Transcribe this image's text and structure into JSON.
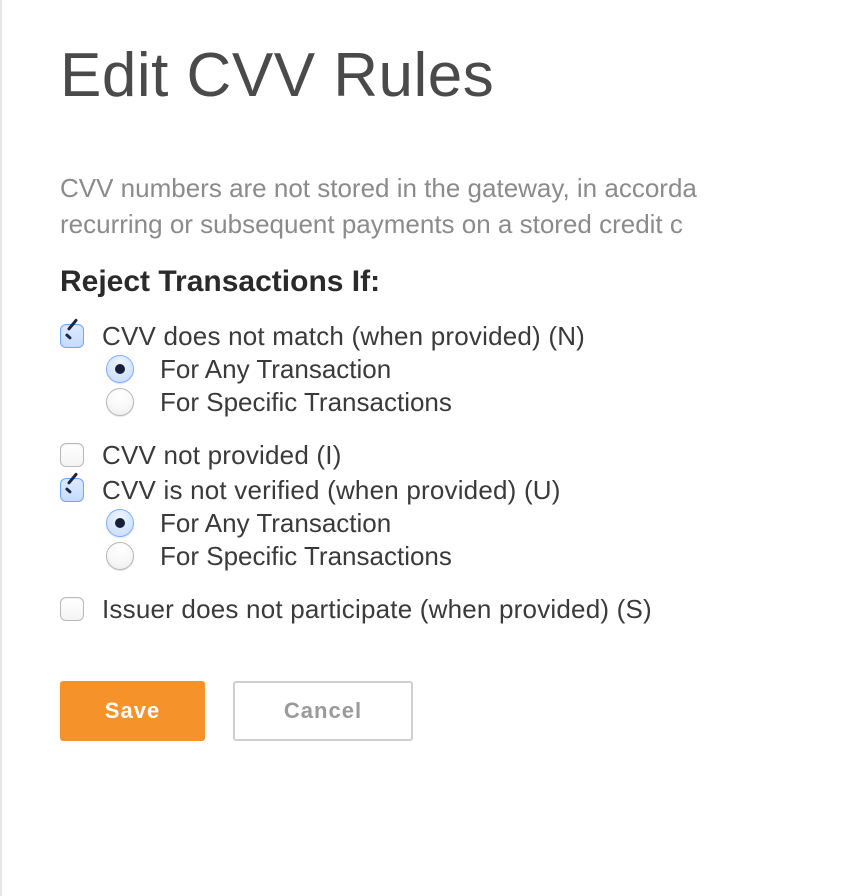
{
  "title": "Edit CVV Rules",
  "intro_line1": "CVV numbers are not stored in the gateway, in accorda",
  "intro_line2": "recurring or subsequent payments on a stored credit c",
  "section_heading": "Reject Transactions If:",
  "rules": [
    {
      "id": "n",
      "label": "CVV does not match (when provided) (N)",
      "checked": true,
      "options": [
        {
          "label": "For Any Transaction",
          "selected": true
        },
        {
          "label": "For Specific Transactions",
          "selected": false
        }
      ]
    },
    {
      "id": "i",
      "label": "CVV not provided (I)",
      "checked": false,
      "options": null
    },
    {
      "id": "u",
      "label": "CVV is not verified (when provided) (U)",
      "checked": true,
      "options": [
        {
          "label": "For Any Transaction",
          "selected": true
        },
        {
          "label": "For Specific Transactions",
          "selected": false
        }
      ]
    },
    {
      "id": "s",
      "label": "Issuer does not participate (when provided) (S)",
      "checked": false,
      "options": null
    }
  ],
  "buttons": {
    "save": "Save",
    "cancel": "Cancel"
  }
}
